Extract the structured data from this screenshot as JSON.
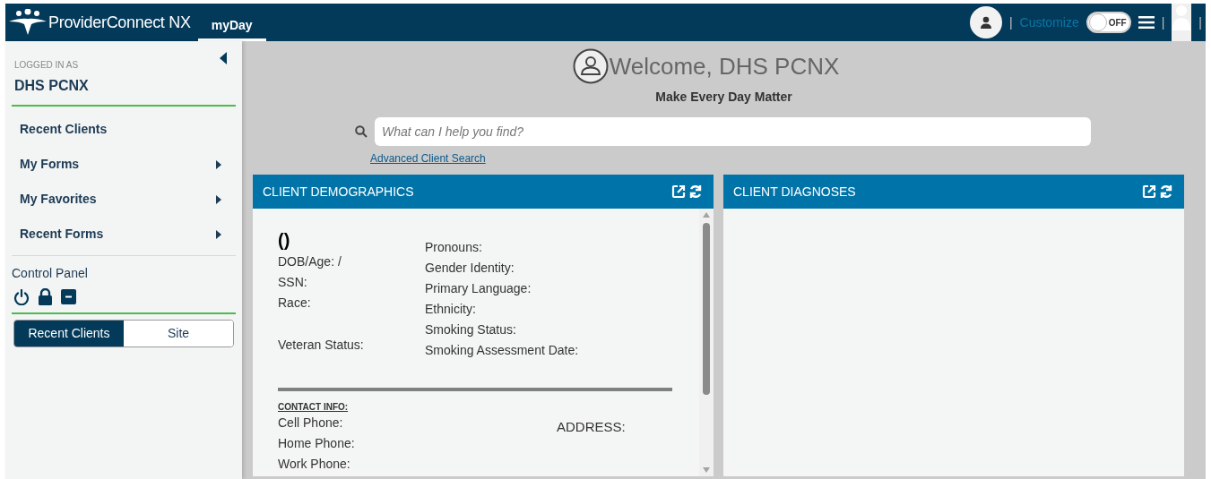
{
  "header": {
    "brand": "ProviderConnect NX",
    "tabs": [
      {
        "label": "myDay",
        "selected": true
      }
    ],
    "separators": [
      "|",
      "|",
      "|"
    ],
    "customize": "Customize",
    "toggle": {
      "label": "OFF",
      "on": false
    }
  },
  "sidebar": {
    "logged_in_label": "LOGGED IN AS",
    "user": "DHS PCNX",
    "items": [
      {
        "label": "Recent Clients",
        "has_submenu": false
      },
      {
        "label": "My Forms",
        "has_submenu": true
      },
      {
        "label": "My Favorites",
        "has_submenu": true
      },
      {
        "label": "Recent Forms",
        "has_submenu": true
      }
    ],
    "control_panel": "Control Panel",
    "segments": [
      {
        "label": "Recent Clients",
        "selected": true
      },
      {
        "label": "Site",
        "selected": false
      }
    ]
  },
  "welcome": {
    "title": "Welcome, DHS PCNX",
    "subtitle": "Make Every Day Matter"
  },
  "search": {
    "placeholder": "What can I help you find?",
    "advanced_link": "Advanced Client Search"
  },
  "panels": [
    {
      "title": "CLIENT DEMOGRAPHICS",
      "kind": "demographics",
      "left_fields": [
        {
          "label": "()",
          "kind": "name"
        },
        {
          "label": "DOB/Age: /",
          "kind": "field"
        },
        {
          "label": "SSN:",
          "kind": "field"
        },
        {
          "label": "Race:",
          "kind": "field"
        },
        {
          "label": "Veteran Status:",
          "kind": "spaced"
        }
      ],
      "right_fields": [
        "Pronouns:",
        "Gender Identity:",
        "Primary Language:",
        "Ethnicity:",
        "Smoking Status:",
        "Smoking Assessment Date:"
      ],
      "contact_heading": "CONTACT INFO:",
      "phones": [
        "Cell Phone:",
        "Home Phone:",
        "Work Phone:"
      ],
      "address": "ADDRESS:"
    },
    {
      "title": "CLIENT DIAGNOSES",
      "kind": "empty"
    }
  ]
}
